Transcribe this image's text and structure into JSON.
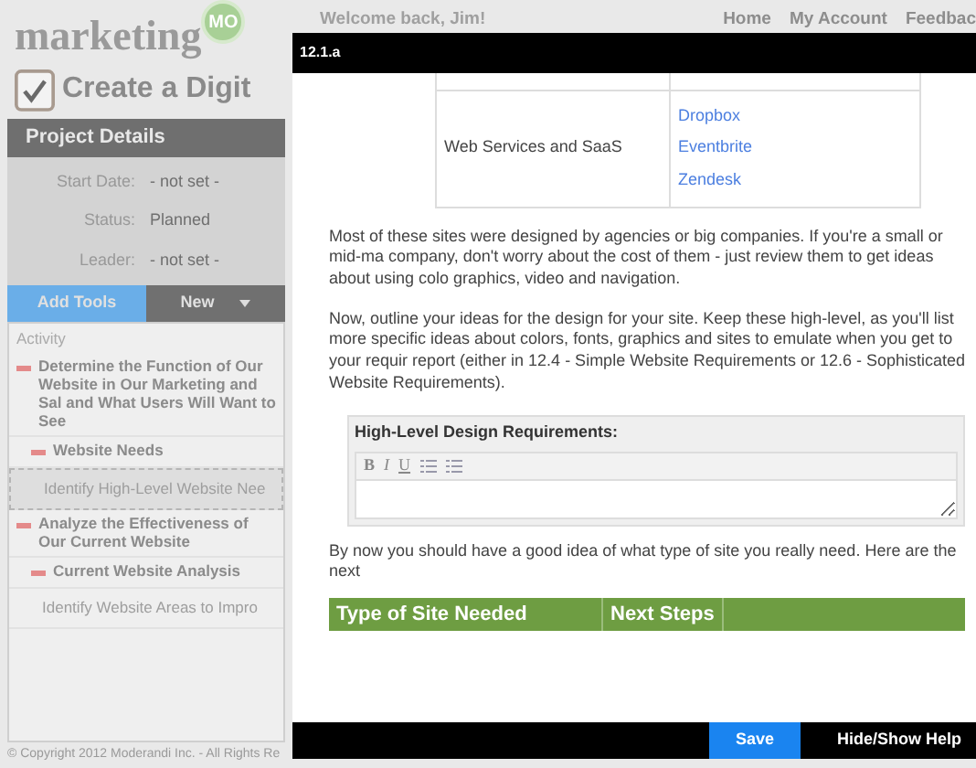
{
  "logo": {
    "text": "marketing",
    "badge": "MO"
  },
  "header": {
    "welcome": "Welcome back, Jim!",
    "nav": [
      "Home",
      "My Account",
      "Feedbac"
    ]
  },
  "page_title": "Create a Digit",
  "project_details": {
    "title": "Project Details",
    "fields": [
      {
        "label": "Start Date:",
        "value": "- not set -"
      },
      {
        "label": "Status:",
        "value": "Planned"
      },
      {
        "label": "Leader:",
        "value": "- not set -"
      }
    ]
  },
  "tools": [
    {
      "label": "Add Tools",
      "selected": true,
      "dropdown": false
    },
    {
      "label": "New",
      "selected": false,
      "dropdown": true
    }
  ],
  "activity": {
    "heading": "Activity",
    "items": [
      {
        "text": "Determine the Function of Our Website in Our Marketing and Sal and What Users Will Want to See",
        "expanded": true,
        "children": [
          {
            "text": "Website Needs",
            "expanded": true,
            "children": [
              {
                "text": "Identify High-Level Website Nee",
                "selected": true
              }
            ]
          }
        ]
      },
      {
        "text": "Analyze the Effectiveness of Our Current Website",
        "expanded": true,
        "children": [
          {
            "text": "Current Website Analysis",
            "expanded": true,
            "children": [
              {
                "text": "Identify Website Areas to Impro",
                "selected": false
              }
            ]
          }
        ]
      }
    ]
  },
  "footer": "© Copyright 2012 Moderandi Inc. - All Rights Re",
  "dialog": {
    "title": "12.1.a",
    "table": {
      "rows": [
        {
          "category": "Web Services and SaaS",
          "links": [
            "Dropbox",
            "Eventbrite",
            "Zendesk"
          ]
        }
      ]
    },
    "paragraphs": [
      "Most of these sites were designed by agencies or big companies. If you're a small or mid-ma company, don't worry about the cost of them - just review them to get ideas about using colo graphics, video and navigation.",
      "Now, outline your ideas for the design for your site. Keep these high-level, as you'll list more specific ideas about colors, fonts, graphics and sites to emulate when you get to your requir report (either in 12.4 - Simple Website Requirements or 12.6 - Sophisticated Website Requirements)."
    ],
    "editor": {
      "label": "High-Level Design Requirements:",
      "format_buttons": [
        "B",
        "I",
        "U"
      ]
    },
    "closing": "By now you should have a good idea of what type of site you really need. Here are the next",
    "steps_table": {
      "columns": [
        "Type of Site Needed",
        "Next Steps"
      ]
    },
    "buttons": [
      {
        "label": "Save",
        "kind": "primary"
      },
      {
        "label": "Hide/Show Help",
        "kind": "plain"
      }
    ]
  }
}
